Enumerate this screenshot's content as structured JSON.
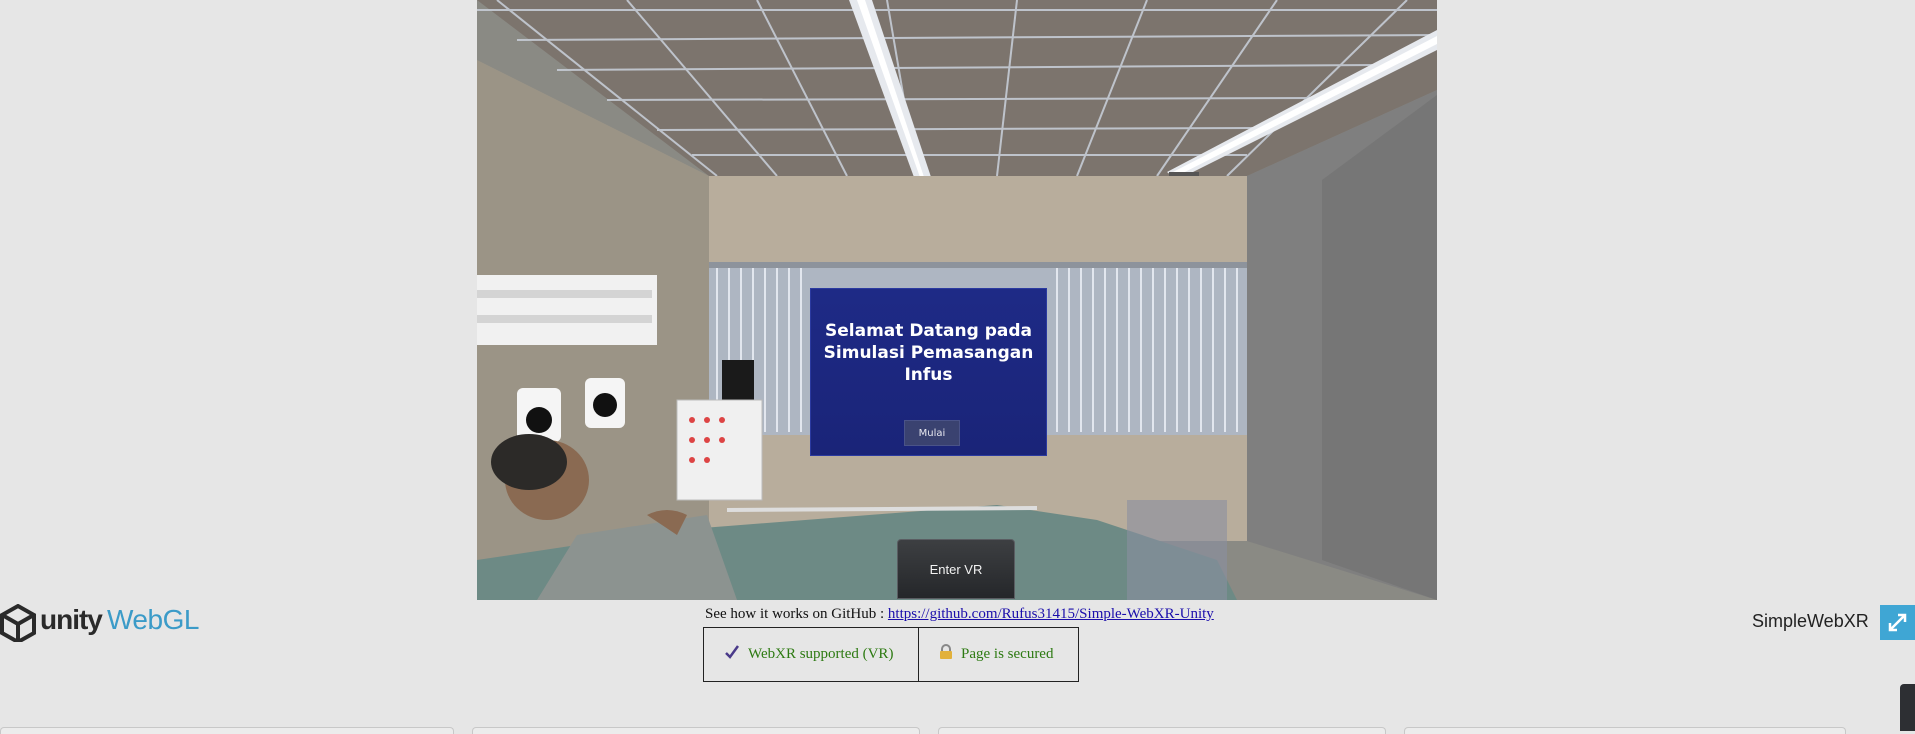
{
  "scene": {
    "welcome_title": "Selamat Datang pada Simulasi Pemasangan Infus",
    "start_button": "Mulai",
    "enter_vr_button": "Enter VR"
  },
  "footer": {
    "logo_unity": "unity",
    "logo_webgl": "WebGL",
    "github_prefix": "See how it works on GitHub : ",
    "github_link": "https://github.com/Rufus31415/Simple-WebXR-Unity",
    "webxr_status": "WebXR supported (VR)",
    "secure_status": "Page is secured",
    "app_name": "SimpleWebXR"
  },
  "icons": {
    "unity_logo": "unity-cube-icon",
    "check": "checkmark-icon",
    "lock": "padlock-icon",
    "fullscreen": "fullscreen-arrows-icon"
  },
  "colors": {
    "background": "#e6e6e6",
    "panel": "#1e2a86",
    "webgl_blue": "#3b9bc8",
    "status_green": "#2d7a12",
    "fullscreen_bg": "#3fa6d4"
  }
}
